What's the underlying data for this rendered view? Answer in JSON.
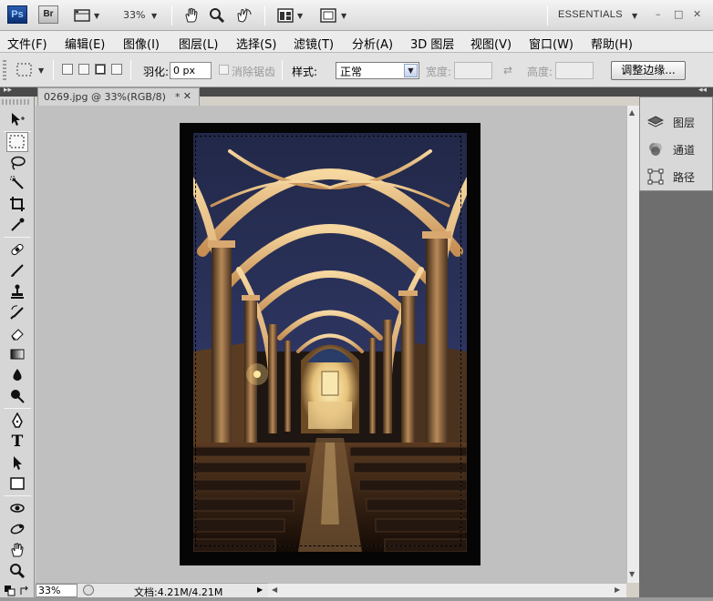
{
  "appbar": {
    "ps_logo": "Ps",
    "br_logo": "Br",
    "zoom": "33%",
    "workspace": "ESSENTIALS",
    "window_controls": {
      "minimize": "–",
      "restore": "□",
      "close": "✕"
    }
  },
  "menu": {
    "items": [
      "文件(F)",
      "编辑(E)",
      "图像(I)",
      "图层(L)",
      "选择(S)",
      "滤镜(T)",
      "分析(A)",
      "3D 图层",
      "视图(V)",
      "窗口(W)",
      "帮助(H)"
    ]
  },
  "options": {
    "feather_label": "羽化:",
    "feather_value": "0 px",
    "antialias_label": "消除锯齿",
    "style_label": "样式:",
    "style_value": "正常",
    "width_label": "宽度:",
    "height_label": "高度:",
    "swap_icon": "⇄",
    "refine_edge_label": "调整边缘..."
  },
  "document": {
    "tab_title": "0269.jpg @ 33%(RGB/8)",
    "tab_modified": "*",
    "tab_close": "✕"
  },
  "status": {
    "zoom": "33%",
    "doc_info": "文档:4.21M/4.21M",
    "arrow": "▶"
  },
  "panels": {
    "items": [
      {
        "label": "图层",
        "icon": "layers-icon"
      },
      {
        "label": "通道",
        "icon": "channels-icon"
      },
      {
        "label": "路径",
        "icon": "paths-icon"
      }
    ]
  },
  "tools": [
    "move-icon",
    "rect-marquee-icon",
    "lasso-icon",
    "quick-select-icon",
    "crop-icon",
    "eyedropper-icon",
    "healing-brush-icon",
    "brush-icon",
    "clone-stamp-icon",
    "history-brush-icon",
    "eraser-icon",
    "gradient-icon",
    "blur-icon",
    "dodge-icon",
    "pen-icon",
    "type-icon",
    "path-select-icon",
    "rectangle-shape-icon",
    "rotate-view-icon",
    "3d-orbit-icon",
    "hand-icon",
    "zoom-icon"
  ],
  "tool_glyphs": {
    "type": "T"
  },
  "colors": {
    "accent_ps": "#0b2f74",
    "canvas_bg": "#c0c0c0",
    "panel_dark": "#6e6e6e"
  }
}
